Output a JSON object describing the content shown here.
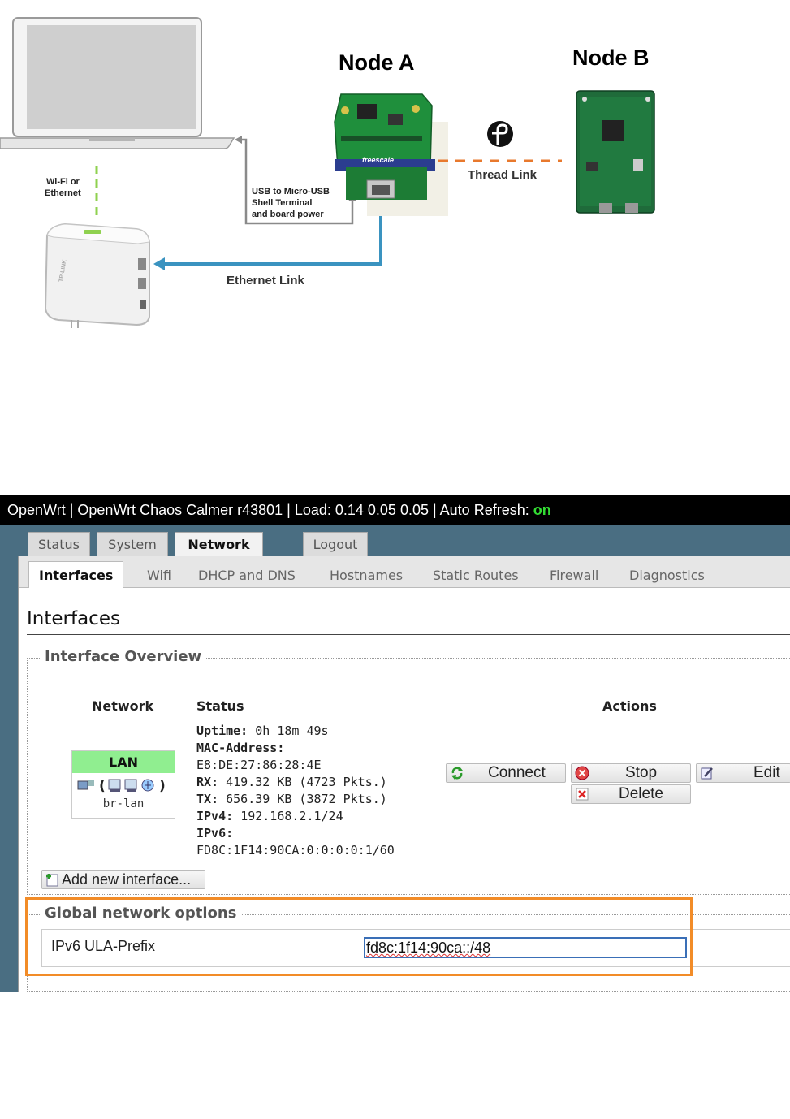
{
  "diagram": {
    "node_a_title": "Node A",
    "node_b_title": "Node B",
    "wifi_label_line1": "Wi-Fi or",
    "wifi_label_line2": "Ethernet",
    "usb_label_line1": "USB to Micro-USB",
    "usb_label_line2": "Shell Terminal",
    "usb_label_line3": "and board power",
    "thread_link_label": "Thread Link",
    "ethernet_link_label": "Ethernet Link",
    "board_brand": "freescale",
    "router_brand": "TP-LINK",
    "colors": {
      "thread_link": "#e8792d",
      "ethernet_link": "#3a93c0",
      "wifi_link": "#8fd14f"
    }
  },
  "openwrt": {
    "topbar": {
      "text": "OpenWrt | OpenWrt Chaos Calmer r43801 | Load: 0.14 0.05 0.05 | Auto Refresh: ",
      "auto_refresh_state": "on"
    },
    "main_tabs": [
      {
        "label": "Status",
        "active": false
      },
      {
        "label": "System",
        "active": false
      },
      {
        "label": "Network",
        "active": true
      },
      {
        "label": "Logout",
        "active": false
      }
    ],
    "sub_tabs": [
      {
        "label": "Interfaces",
        "active": true
      },
      {
        "label": "Wifi"
      },
      {
        "label": "DHCP and DNS"
      },
      {
        "label": "Hostnames"
      },
      {
        "label": "Static Routes"
      },
      {
        "label": "Firewall"
      },
      {
        "label": "Diagnostics"
      }
    ],
    "page_title": "Interfaces",
    "overview": {
      "legend": "Interface Overview",
      "headers": {
        "network": "Network",
        "status": "Status",
        "actions": "Actions"
      },
      "interface": {
        "name": "LAN",
        "device": "br-lan",
        "status": {
          "uptime_label": "Uptime:",
          "uptime": "0h 18m 49s",
          "mac_label": "MAC-Address:",
          "mac": "E8:DE:27:86:28:4E",
          "rx_label": "RX:",
          "rx": "419.32 KB (4723 Pkts.)",
          "tx_label": "TX:",
          "tx": "656.39 KB (3872 Pkts.)",
          "ipv4_label": "IPv4:",
          "ipv4": "192.168.2.1/24",
          "ipv6_label": "IPv6:",
          "ipv6": "FD8C:1F14:90CA:0:0:0:0:1/60"
        },
        "actions": {
          "connect": "Connect",
          "stop": "Stop",
          "edit": "Edit",
          "delete": "Delete"
        }
      },
      "add_button": "Add new interface..."
    },
    "global": {
      "legend": "Global network options",
      "ula_label": "IPv6 ULA-Prefix",
      "ula_value": "fd8c:1f14:90ca::/48",
      "highlight_color": "#f28c28"
    }
  }
}
